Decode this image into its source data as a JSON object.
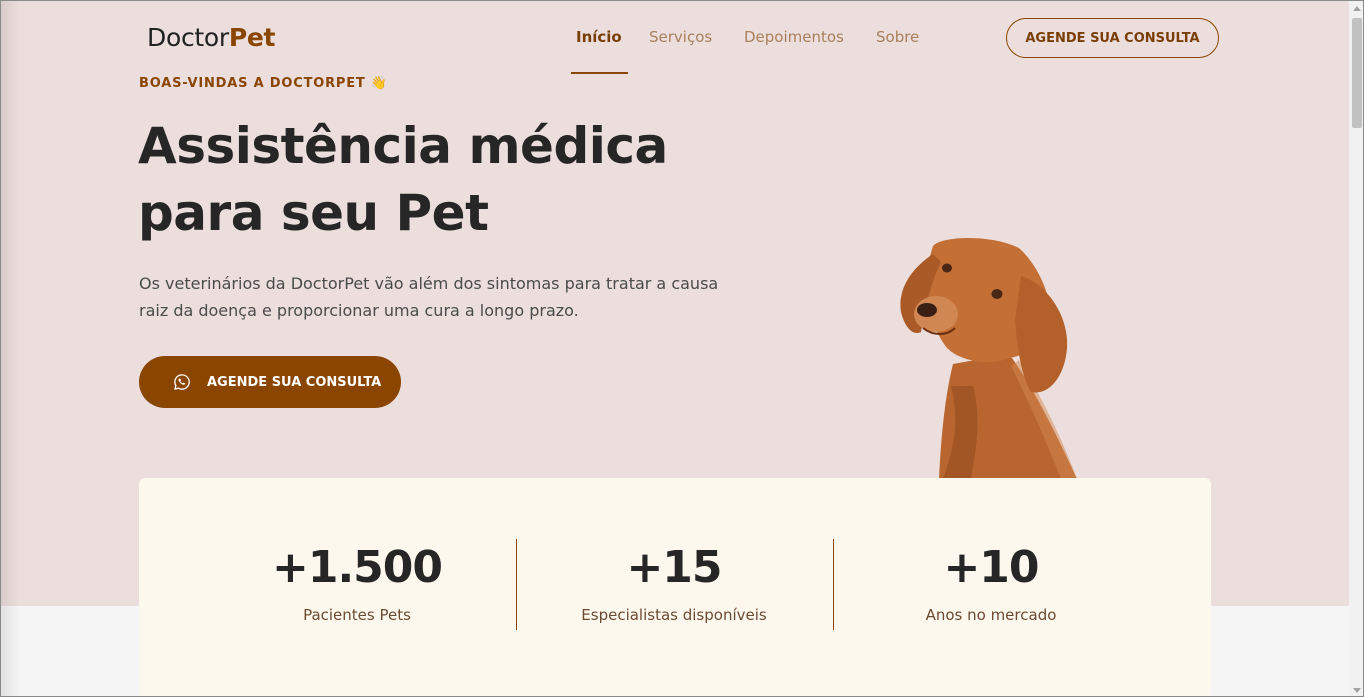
{
  "header": {
    "logo": {
      "part1": "Doctor",
      "part2": "Pet"
    },
    "nav": [
      {
        "label": "Início",
        "active": true
      },
      {
        "label": "Serviços",
        "active": false
      },
      {
        "label": "Depoimentos",
        "active": false
      },
      {
        "label": "Sobre",
        "active": false
      }
    ],
    "cta_label": "AGENDE SUA CONSULTA"
  },
  "hero": {
    "eyebrow": "BOAS-VINDAS A DOCTORPET 👋",
    "title_line1": "Assistência médica",
    "title_line2": "para seu Pet",
    "description": "Os veterinários da DoctorPet vão além dos sintomas para tratar a causa raiz da doença e proporcionar uma cura a longo prazo.",
    "cta_label": "AGENDE SUA CONSULTA",
    "cta_icon": "whatsapp-icon",
    "image": "dog-photo"
  },
  "stats": [
    {
      "value": "+1.500",
      "label": "Pacientes Pets"
    },
    {
      "value": "+15",
      "label": "Especialistas disponíveis"
    },
    {
      "value": "+10",
      "label": "Anos no mercado"
    }
  ],
  "colors": {
    "brand": "#8a4500",
    "hero_background": "#ebdedc",
    "stats_background": "#fdf8ee",
    "text_dark": "#262626"
  }
}
